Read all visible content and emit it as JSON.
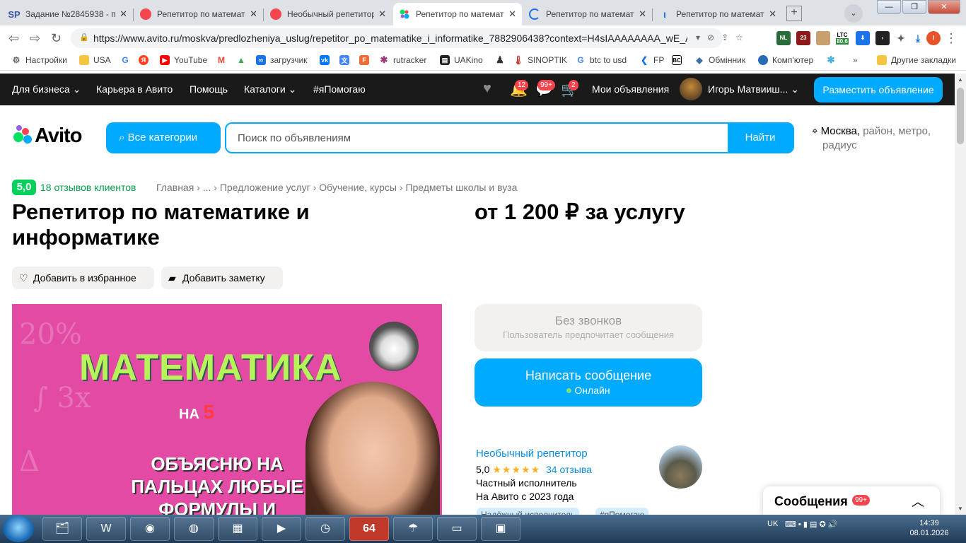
{
  "browser": {
    "tabs": [
      {
        "favicon": "SP",
        "title": "Задание №2845938 - п",
        "color": "#3b5ba8",
        "active": false
      },
      {
        "favicon": "",
        "title": "Репетитор по математи",
        "color": "#f5454e",
        "active": false
      },
      {
        "favicon": "",
        "title": "Необычный репетитор",
        "color": "#f5454e",
        "active": false
      },
      {
        "favicon": "",
        "title": "Репетитор по математи",
        "color": "#00aaff",
        "active": true
      },
      {
        "favicon": "",
        "title": "Репетитор по математи",
        "color": "#1a73e8",
        "active": false
      },
      {
        "favicon": "",
        "title": "Репетитор по математи",
        "color": "#1a73e8",
        "active": false
      }
    ],
    "tab_close": "✕",
    "url": "https://www.avito.ru/moskva/predlozheniya_uslug/repetitor_po_matematike_i_informatike_7882906438?context=H4sIAAAAAAAA_wE_A...",
    "extensions": [
      {
        "label": "NL",
        "color": "#2a6b3a"
      },
      {
        "label": "23",
        "color": "#8a1a1a"
      },
      {
        "label": "",
        "color": "#c8a070"
      },
      {
        "label": "80.6",
        "color": "#2a8a3a"
      },
      {
        "label": "⬇",
        "color": "#1a73e8"
      },
      {
        "label": "›",
        "color": "#222"
      },
      {
        "label": "✦",
        "color": "#5f6368"
      },
      {
        "label": "⤓",
        "color": "#1a73e8"
      },
      {
        "label": "I",
        "color": "#e8542a"
      }
    ],
    "ext_ltc": "LTC",
    "bookmarks": [
      {
        "label": "Настройки",
        "icon": "gear-icon",
        "color": "#5f6368"
      },
      {
        "label": "USA",
        "icon": "folder-icon",
        "color": "#f4c542"
      },
      {
        "label": "",
        "icon": "google-icon",
        "color": "#4285f4"
      },
      {
        "label": "",
        "icon": "yandex-icon",
        "color": "#fc3f1d"
      },
      {
        "label": "YouTube",
        "icon": "youtube-icon",
        "color": "#ff0000"
      },
      {
        "label": "",
        "icon": "gmail-icon",
        "color": "#ea4335"
      },
      {
        "label": "",
        "icon": "drive-icon",
        "color": "#34a853"
      },
      {
        "label": "загрузчик",
        "icon": "infinity-icon",
        "color": "#1a73e8"
      },
      {
        "label": "",
        "icon": "vk-icon",
        "color": "#0077ff"
      },
      {
        "label": "",
        "icon": "translate-icon",
        "color": "#4285f4"
      },
      {
        "label": "",
        "icon": "f-icon",
        "color": "#f06a35"
      },
      {
        "label": "rutracker",
        "icon": "star-icon",
        "color": "#9b3a7a"
      },
      {
        "label": "UAKino",
        "icon": "film-icon",
        "color": "#222"
      },
      {
        "label": "",
        "icon": "figure-icon",
        "color": "#333"
      },
      {
        "label": "SINOPTIK",
        "icon": "thermometer-icon",
        "color": "#c0392b"
      },
      {
        "label": "btc to usd",
        "icon": "google-icon",
        "color": "#4285f4"
      },
      {
        "label": "FP",
        "icon": "fp-icon",
        "color": "#1a73e8"
      },
      {
        "label": "",
        "icon": "bc-icon",
        "color": "#000"
      },
      {
        "label": "Обмінник",
        "icon": "diamond-icon",
        "color": "#3c6ea8"
      },
      {
        "label": "Комп'ютер",
        "icon": "planet-icon",
        "color": "#2a6bb8"
      },
      {
        "label": "",
        "icon": "snowflake-icon",
        "color": "#29a8e0"
      }
    ],
    "bookmarks_more": "»",
    "other_bookmarks": "Другие закладки"
  },
  "avito_header": {
    "links": [
      "Для бизнеса",
      "Карьера в Авито",
      "Помощь",
      "Каталоги",
      "#яПомогаю"
    ],
    "notif_badge": "12",
    "messages_badge": "99+",
    "cart_badge": "2",
    "my_ads": "Мои объявления",
    "user_name": "Игорь Матвииш...",
    "place_ad": "Разместить объявление"
  },
  "search": {
    "logo": "Avito",
    "categories_label": "Все категории",
    "placeholder": "Поиск по объявлениям",
    "button": "Найти",
    "location_main": "Москва,",
    "location_rest": "район, метро,",
    "location_line2": "радиус"
  },
  "listing": {
    "rating": "5,0",
    "reviews": "18 отзывов клиентов",
    "breadcrumbs": "Главная  ›  ...  ›  Предложение услуг  ›  Обучение, курсы  ›  Предметы школы и вуза",
    "title": "Репетитор по математике и информатике",
    "price": "от 1 200 ₽ за услугу",
    "fav_button": "Добавить в избранное",
    "note_button": "Добавить заметку",
    "image_text": {
      "headline": "МАТЕМАТИКА",
      "on": "НА",
      "five": "5",
      "body": "ОБЪЯСНЮ НА ПАЛЬЦАХ ЛЮБЫЕ ФОРМУЛЫ И"
    }
  },
  "contact": {
    "no_calls_title": "Без звонков",
    "no_calls_sub": "Пользователь предпочитает сообщения",
    "write_button": "Написать сообщение",
    "online": "Онлайн"
  },
  "seller": {
    "name": "Необычный репетитор",
    "rating": "5,0",
    "stars": "★★★★★",
    "reviews": "34 отзыва",
    "type": "Частный исполнитель",
    "since": "На Авито с 2023 года",
    "tags": [
      "Надёжный исполнитель",
      "#яПомогаю"
    ]
  },
  "messages_widget": {
    "label": "Сообщения",
    "badge": "99+"
  },
  "taskbar": {
    "lang": "UK",
    "time": "14:39",
    "date": "08.01.2026",
    "apps": [
      "file-manager-icon",
      "shield-app-icon",
      "chrome-icon",
      "globe-app-icon",
      "spreadsheet-app-icon",
      "media-player-icon",
      "clock-app-icon",
      "64-app-icon",
      "umbrella-app-icon",
      "notepad-app-icon",
      "monitor-app-icon"
    ],
    "app_64": "64"
  }
}
